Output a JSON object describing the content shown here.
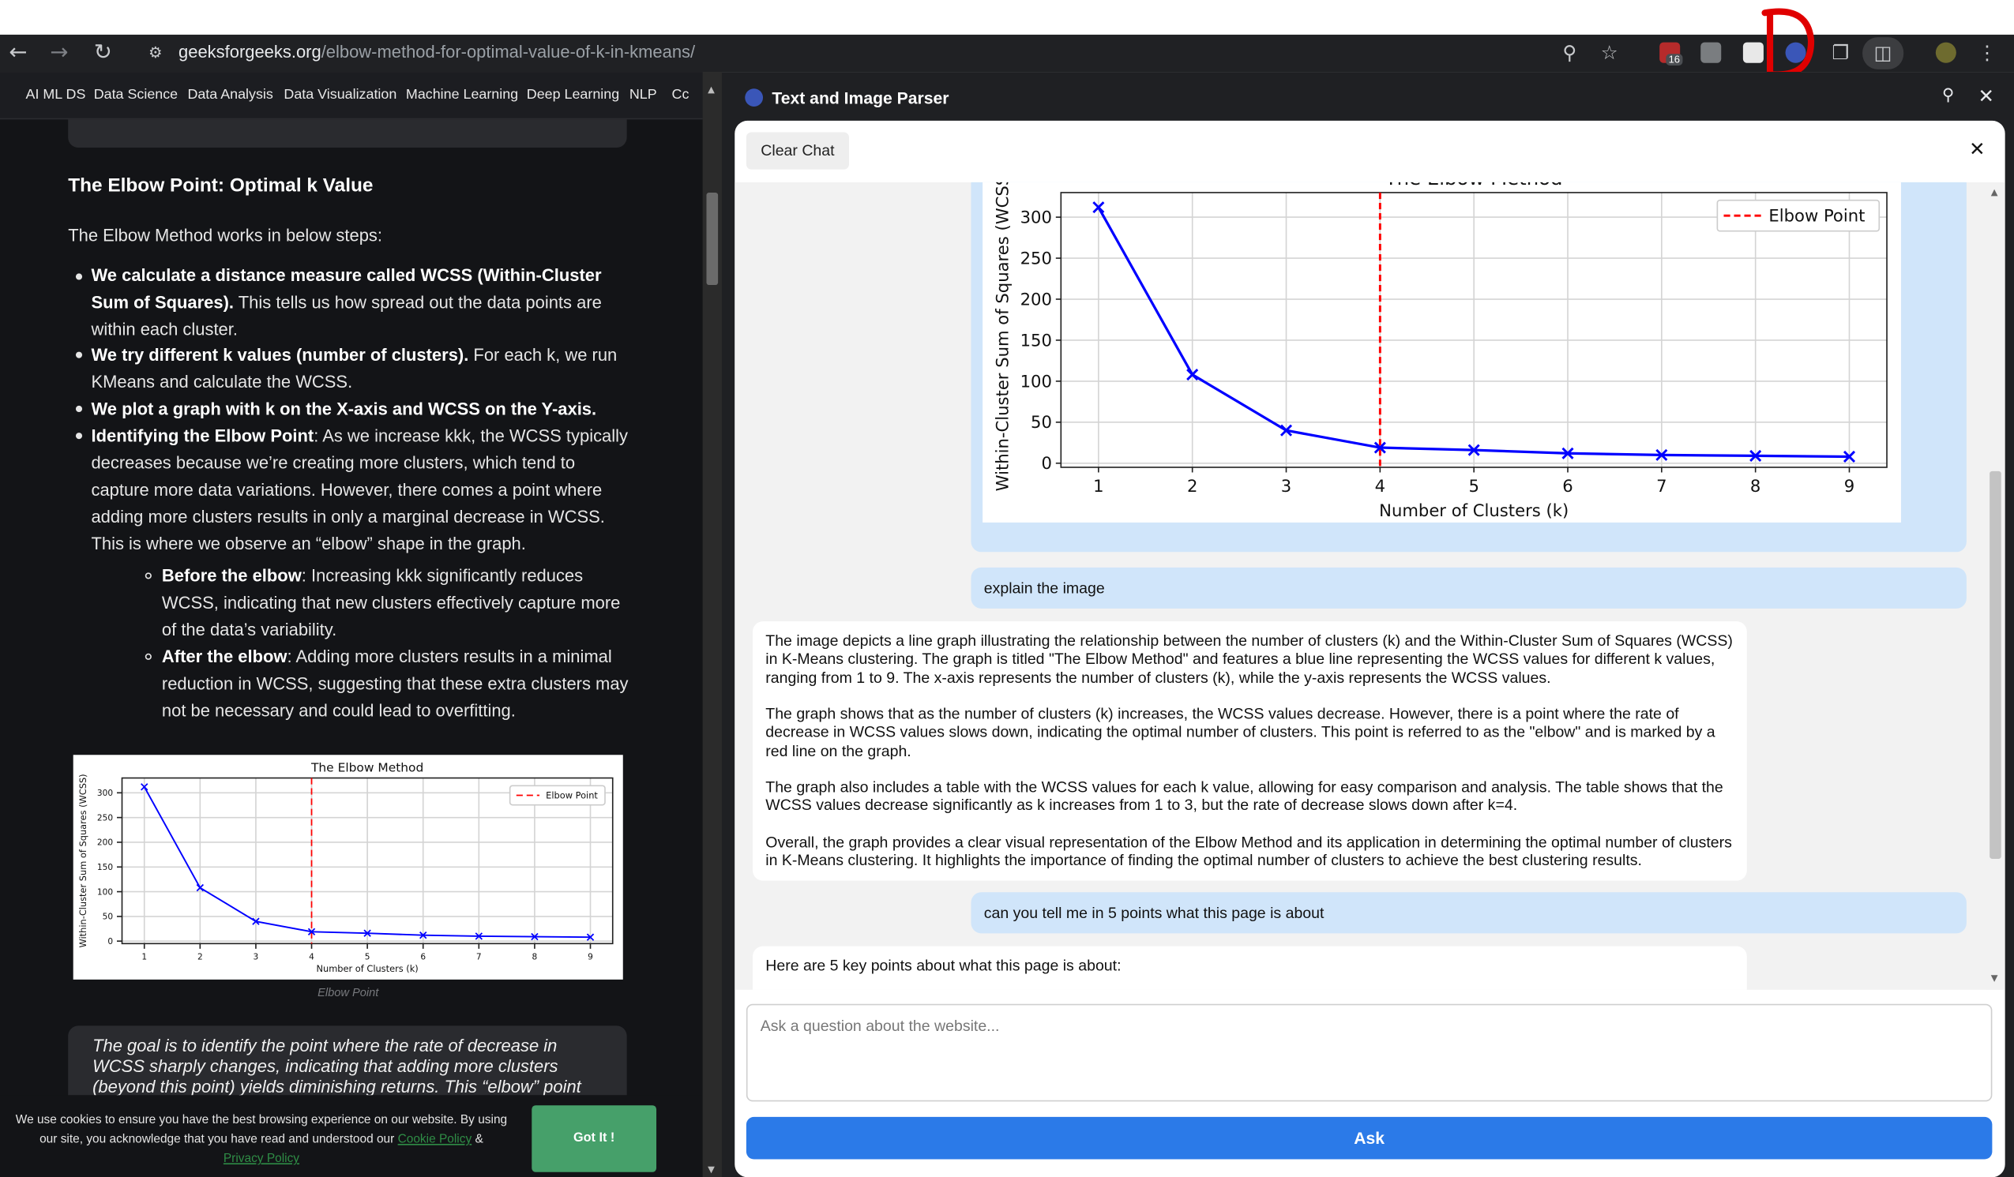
{
  "browser": {
    "url_domain": "geeksforgeeks.org",
    "url_path": "/elbow-method-for-optimal-value-of-k-in-kmeans/",
    "extension_badge": "16",
    "icons": [
      "back-arrow-icon",
      "forward-arrow-icon",
      "reload-icon",
      "site-info-icon",
      "zoom-icon",
      "bookmark-star-icon",
      "puzzle-icon",
      "side-panel-icon",
      "menu-icon"
    ]
  },
  "left": {
    "categories": [
      "AI ML DS",
      "Data Science",
      "Data Analysis",
      "Data Visualization",
      "Machine Learning",
      "Deep Learning",
      "NLP",
      "Cc"
    ],
    "section_title": "The Elbow Point: Optimal k Value",
    "intro": "The Elbow Method works in below steps:",
    "bullets": [
      {
        "bold": "We calculate a distance measure called WCSS (Within-Cluster Sum of Squares).",
        "text": " This tells us how spread out the data points are within each cluster."
      },
      {
        "bold": "We try different k values (number of clusters).",
        "text": " For each k, we run KMeans and calculate the WCSS."
      },
      {
        "bold": "We plot a graph with k on the X-axis and WCSS on the Y-axis.",
        "text": ""
      },
      {
        "bold": "Identifying the Elbow Point",
        "text": ": As we increase kkk, the WCSS typically decreases because we’re creating more clusters, which tend to capture more data variations. However, there comes a point where adding more clusters results in only a marginal decrease in WCSS. This is where we observe an “elbow” shape in the graph."
      }
    ],
    "sub_bullets": [
      {
        "bold": "Before the elbow",
        "text": ": Increasing kkk significantly reduces WCSS, indicating that new clusters effectively capture more of the data’s variability."
      },
      {
        "bold": "After the elbow",
        "text": ": Adding more clusters results in a minimal reduction in WCSS, suggesting that these extra clusters may not be necessary and could lead to overfitting."
      }
    ],
    "image_caption": "Elbow Point",
    "quote": "The goal is to identify the point where the rate of decrease in WCSS sharply changes, indicating that adding more clusters (beyond this point) yields diminishing returns. This “elbow” point",
    "cookie": {
      "text_before": "We use cookies to ensure you have the best browsing experience on our website. By using our site, you acknowledge that you have read and understood our ",
      "link1": "Cookie Policy",
      "between": " & ",
      "link2": "Privacy Policy",
      "button": "Got It !"
    }
  },
  "panel": {
    "title": "Text and Image Parser",
    "clear_button": "Clear Chat",
    "messages": [
      {
        "role": "user",
        "text": "explain the image"
      },
      {
        "role": "assistant",
        "paragraphs": [
          "The image depicts a line graph illustrating the relationship between the number of clusters (k) and the Within-Cluster Sum of Squares (WCSS) in K-Means clustering. The graph is titled \"The Elbow Method\" and features a blue line representing the WCSS values for different k values, ranging from 1 to 9. The x-axis represents the number of clusters (k), while the y-axis represents the WCSS values.",
          "The graph shows that as the number of clusters (k) increases, the WCSS values decrease. However, there is a point where the rate of decrease in WCSS values slows down, indicating the optimal number of clusters. This point is referred to as the \"elbow\" and is marked by a red line on the graph.",
          "The graph also includes a table with the WCSS values for each k value, allowing for easy comparison and analysis. The table shows that the WCSS values decrease significantly as k increases from 1 to 3, but the rate of decrease slows down after k=4.",
          "Overall, the graph provides a clear visual representation of the Elbow Method and its application in determining the optimal number of clusters in K-Means clustering. It highlights the importance of finding the optimal number of clusters to achieve the best clustering results."
        ]
      },
      {
        "role": "user",
        "text": "can you tell me in 5 points what this page is about"
      },
      {
        "role": "assistant",
        "paragraphs": [
          "Here are 5 key points about what this page is about:"
        ]
      }
    ],
    "input_placeholder": "Ask a question about the website...",
    "ask_button": "Ask"
  },
  "chart_data": {
    "type": "line",
    "title": "The Elbow Method",
    "xlabel": "Number of Clusters (k)",
    "ylabel": "Within-Cluster Sum of Squares (WCSS)",
    "x": [
      1,
      2,
      3,
      4,
      5,
      6,
      7,
      8,
      9
    ],
    "series": [
      {
        "values": [
          312,
          108,
          40,
          19,
          16,
          12,
          10,
          9,
          8
        ],
        "color": "#0000ff",
        "marker": "x"
      }
    ],
    "reference_lines": [
      {
        "type": "vertical",
        "x": 4,
        "label": "Elbow Point",
        "color": "#ff0000",
        "style": "dashed"
      }
    ],
    "xticks": [
      1,
      2,
      3,
      4,
      5,
      6,
      7,
      8,
      9
    ],
    "yticks": [
      0,
      50,
      100,
      150,
      200,
      250,
      300
    ],
    "xlim": [
      0.6,
      9.4
    ],
    "ylim": [
      -5,
      330
    ],
    "grid": true,
    "legend": "top-right"
  },
  "colors": {
    "chrome_bg": "#202124",
    "page_bg": "#131417",
    "link_green": "#2f8d46",
    "ask_blue": "#2b7ae8",
    "user_bubble": "#d0e5fa"
  }
}
